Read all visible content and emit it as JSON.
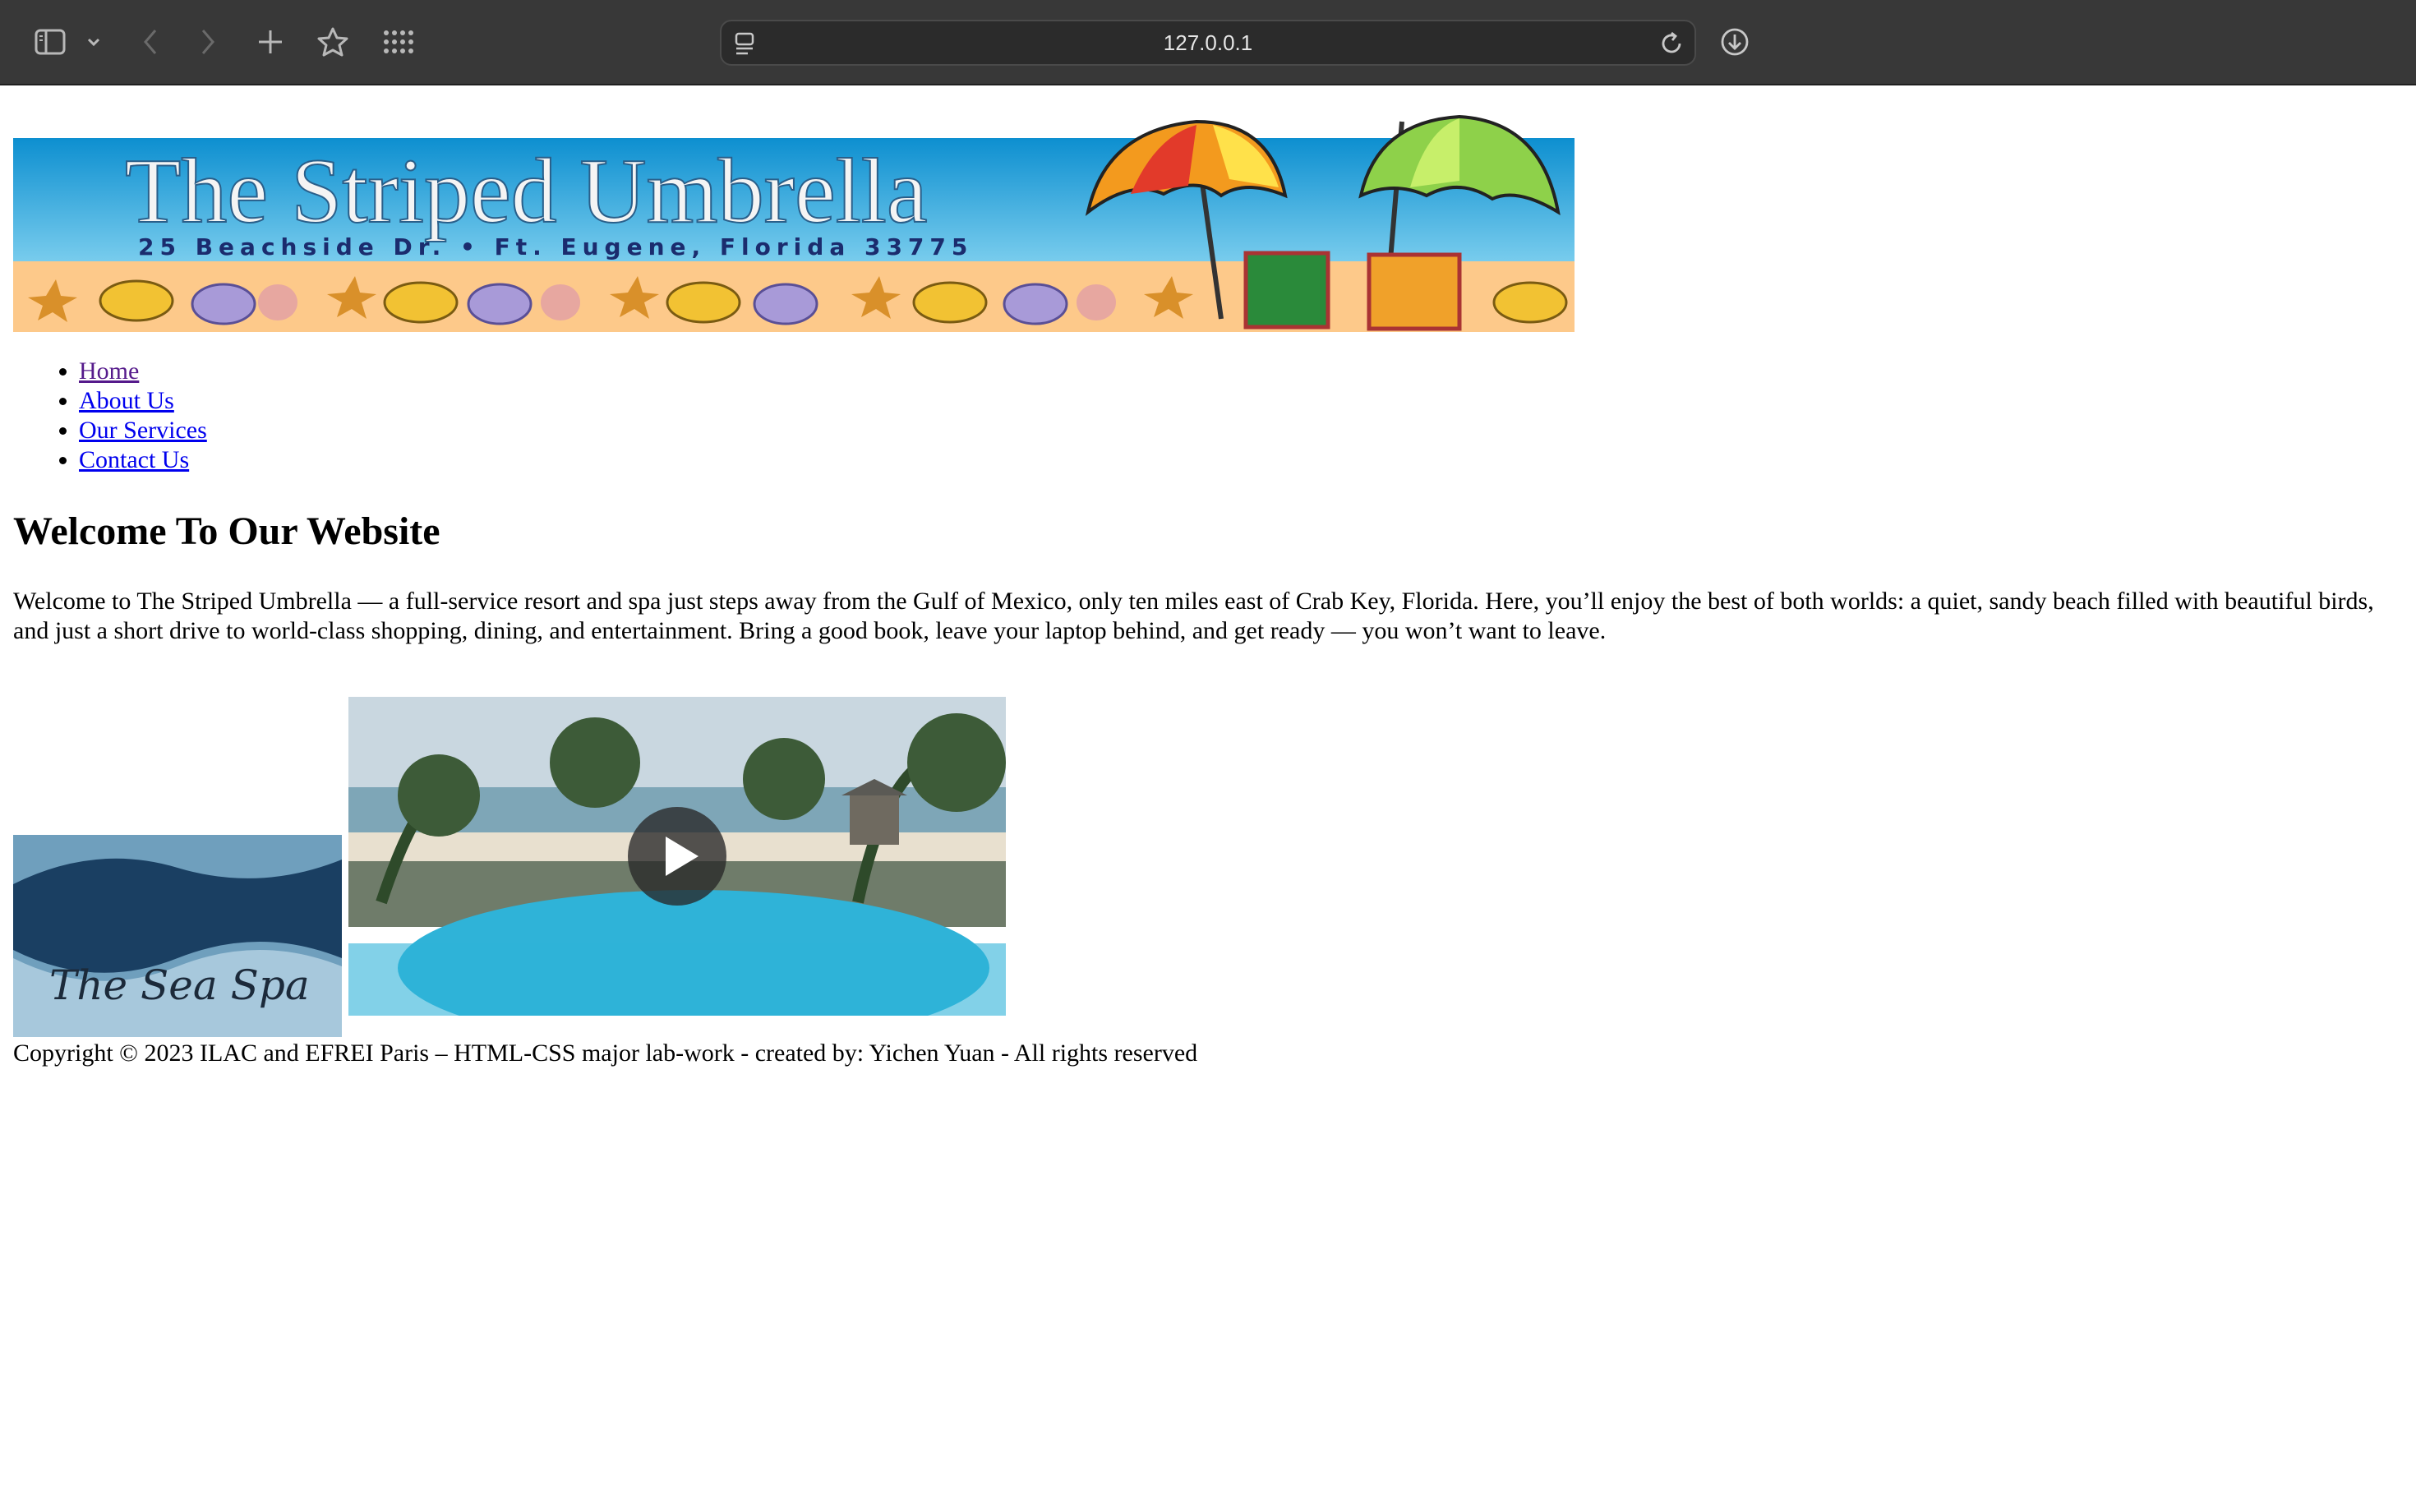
{
  "browser": {
    "url": "127.0.0.1",
    "icons": {
      "sidebar": "sidebar-icon",
      "tab_overview": "chevron-down-icon",
      "back": "back-arrow-icon",
      "forward": "forward-arrow-icon",
      "new_tab": "plus-icon",
      "bookmark": "star-icon",
      "apps": "grid-icon",
      "page_menu": "page-menu-icon",
      "reload": "reload-icon",
      "downloads": "download-icon"
    }
  },
  "banner": {
    "title": "The Striped Umbrella",
    "address": "25 Beachside Dr. • Ft. Eugene, Florida 33775"
  },
  "nav": {
    "items": [
      {
        "label": "Home",
        "visited": true
      },
      {
        "label": "About Us",
        "visited": false
      },
      {
        "label": "Our Services",
        "visited": false
      },
      {
        "label": "Contact Us",
        "visited": false
      }
    ]
  },
  "main": {
    "heading": "Welcome To Our Website",
    "intro": "Welcome to The Striped Umbrella — a full-service resort and spa just steps away from the Gulf of Mexico, only ten miles east of Crab Key, Florida. Here, you’ll enjoy the best of both worlds: a quiet, sandy beach filled with beautiful birds, and just a short drive to world-class shopping, dining, and entertainment. Bring a good book, leave your laptop behind, and get ready — you won’t want to leave.",
    "spa_logo_text": "The Sea Spa"
  },
  "footer": {
    "text": "Copyright © 2023 ILAC and EFREI Paris – HTML-CSS major lab-work - created by: Yichen Yuan - All rights reserved"
  },
  "colors": {
    "chrome_bg": "#383838",
    "link": "#0000ee",
    "visited_link": "#551a8b",
    "banner_sky": "#1aa3d9",
    "banner_sand": "#fdc98a"
  }
}
